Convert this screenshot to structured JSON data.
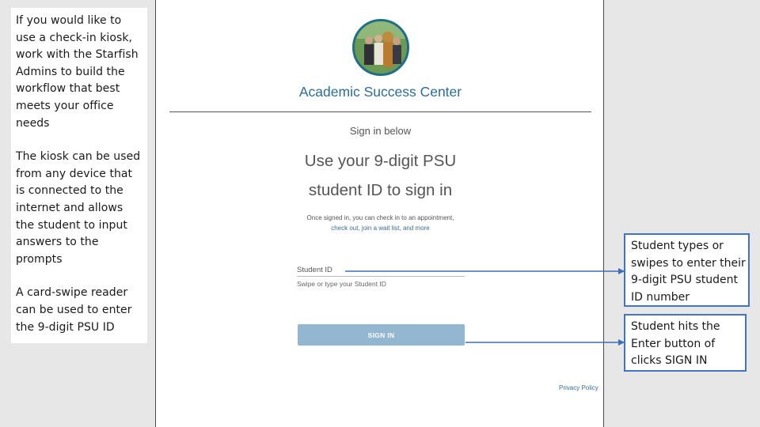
{
  "left_panel": {
    "paragraph1": "If you would like to use a check-in kiosk, work with the Starfish Admins to build the workflow that best meets your office needs",
    "paragraph2": "The kiosk can be used from any device that is connected to the internet and allows the student to input answers to the prompts",
    "paragraph3": "A card-swipe reader can be used to enter the 9-digit PSU ID"
  },
  "kiosk": {
    "title": "Academic Success Center",
    "subtitle": "Sign in below",
    "headline_line1": "Use your 9-digit PSU",
    "headline_line2": "student ID to sign in",
    "info_line1": "Once signed in, you can check in to an appointment,",
    "info_line2": "check out, join a wait list, and more",
    "field_label": "Student ID",
    "field_placeholder": "Swipe or type your Student ID",
    "field_value": "",
    "sign_in_label": "SIGN IN",
    "privacy_label": "Privacy Policy"
  },
  "callouts": {
    "student_id": "Student types or swipes to enter their 9-digit PSU student ID number",
    "sign_in": "Student hits the Enter button of clicks SIGN IN"
  },
  "colors": {
    "accent_title": "#2b6e97",
    "button": "#93b7d0",
    "callout_border": "#4472c4"
  },
  "icons": {
    "avatar": "group-photo-avatar",
    "arrow": "arrow-left-icon"
  }
}
